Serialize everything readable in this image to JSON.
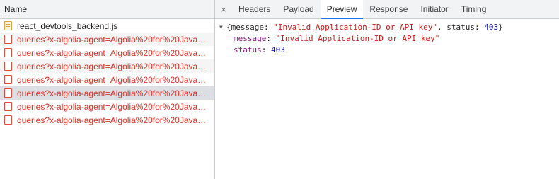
{
  "network_list": {
    "column_header": "Name",
    "requests": [
      {
        "name": "react_devtools_backend.js",
        "type": "script",
        "status": "ok"
      },
      {
        "name": "queries?x-algolia-agent=Algolia%20for%20JavaScript…",
        "type": "fetch",
        "status": "error"
      },
      {
        "name": "queries?x-algolia-agent=Algolia%20for%20JavaScript…",
        "type": "fetch",
        "status": "error"
      },
      {
        "name": "queries?x-algolia-agent=Algolia%20for%20JavaScript…",
        "type": "fetch",
        "status": "error"
      },
      {
        "name": "queries?x-algolia-agent=Algolia%20for%20JavaScript…",
        "type": "fetch",
        "status": "error"
      },
      {
        "name": "queries?x-algolia-agent=Algolia%20for%20JavaScript…",
        "type": "fetch",
        "status": "error",
        "selected": true
      },
      {
        "name": "queries?x-algolia-agent=Algolia%20for%20JavaScript…",
        "type": "fetch",
        "status": "error"
      },
      {
        "name": "queries?x-algolia-agent=Algolia%20for%20JavaScript…",
        "type": "fetch",
        "status": "error"
      }
    ]
  },
  "detail": {
    "close_icon": "×",
    "tabs": [
      {
        "label": "Headers"
      },
      {
        "label": "Payload"
      },
      {
        "label": "Preview",
        "active": true
      },
      {
        "label": "Response"
      },
      {
        "label": "Initiator"
      },
      {
        "label": "Timing"
      }
    ],
    "preview": {
      "toggle_icon": "▼",
      "summary_open": "{message: ",
      "summary_message": "\"Invalid Application-ID or API key\"",
      "summary_mid": ", status: ",
      "summary_status": "403",
      "summary_close": "}",
      "message_key": "message",
      "message_value": "\"Invalid Application-ID or API key\"",
      "status_key": "status",
      "status_value": "403",
      "separator": ": "
    }
  },
  "colors": {
    "error_text": "#d93025",
    "active_tab_underline": "#1a73e8",
    "selected_row": "#dcdfe3"
  }
}
